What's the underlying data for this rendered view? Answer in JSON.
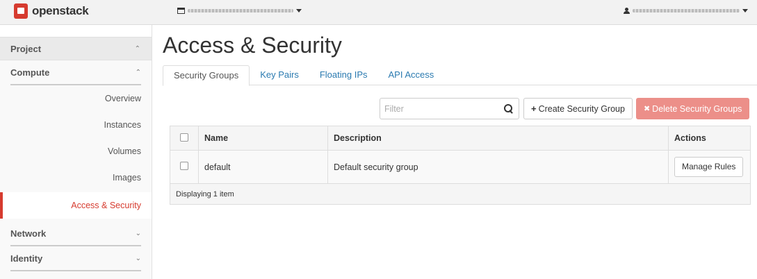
{
  "topbar": {
    "brand": "openstack",
    "project_selector": "",
    "user_menu": ""
  },
  "sidebar": {
    "project": "Project",
    "compute": "Compute",
    "items": [
      "Overview",
      "Instances",
      "Volumes",
      "Images",
      "Access & Security"
    ],
    "network": "Network",
    "identity": "Identity"
  },
  "main": {
    "title": "Access & Security",
    "tabs": [
      "Security Groups",
      "Key Pairs",
      "Floating IPs",
      "API Access"
    ],
    "filter_placeholder": "Filter",
    "create_label": "Create Security Group",
    "delete_label": "Delete Security Groups",
    "table": {
      "headers": [
        "Name",
        "Description",
        "Actions"
      ],
      "rows": [
        {
          "name": "default",
          "description": "Default security group",
          "action": "Manage Rules"
        }
      ],
      "footer": "Displaying 1 item"
    }
  },
  "colors": {
    "accent": "#d63b2f",
    "link": "#2a7ab0",
    "danger": "#ec8f89"
  }
}
